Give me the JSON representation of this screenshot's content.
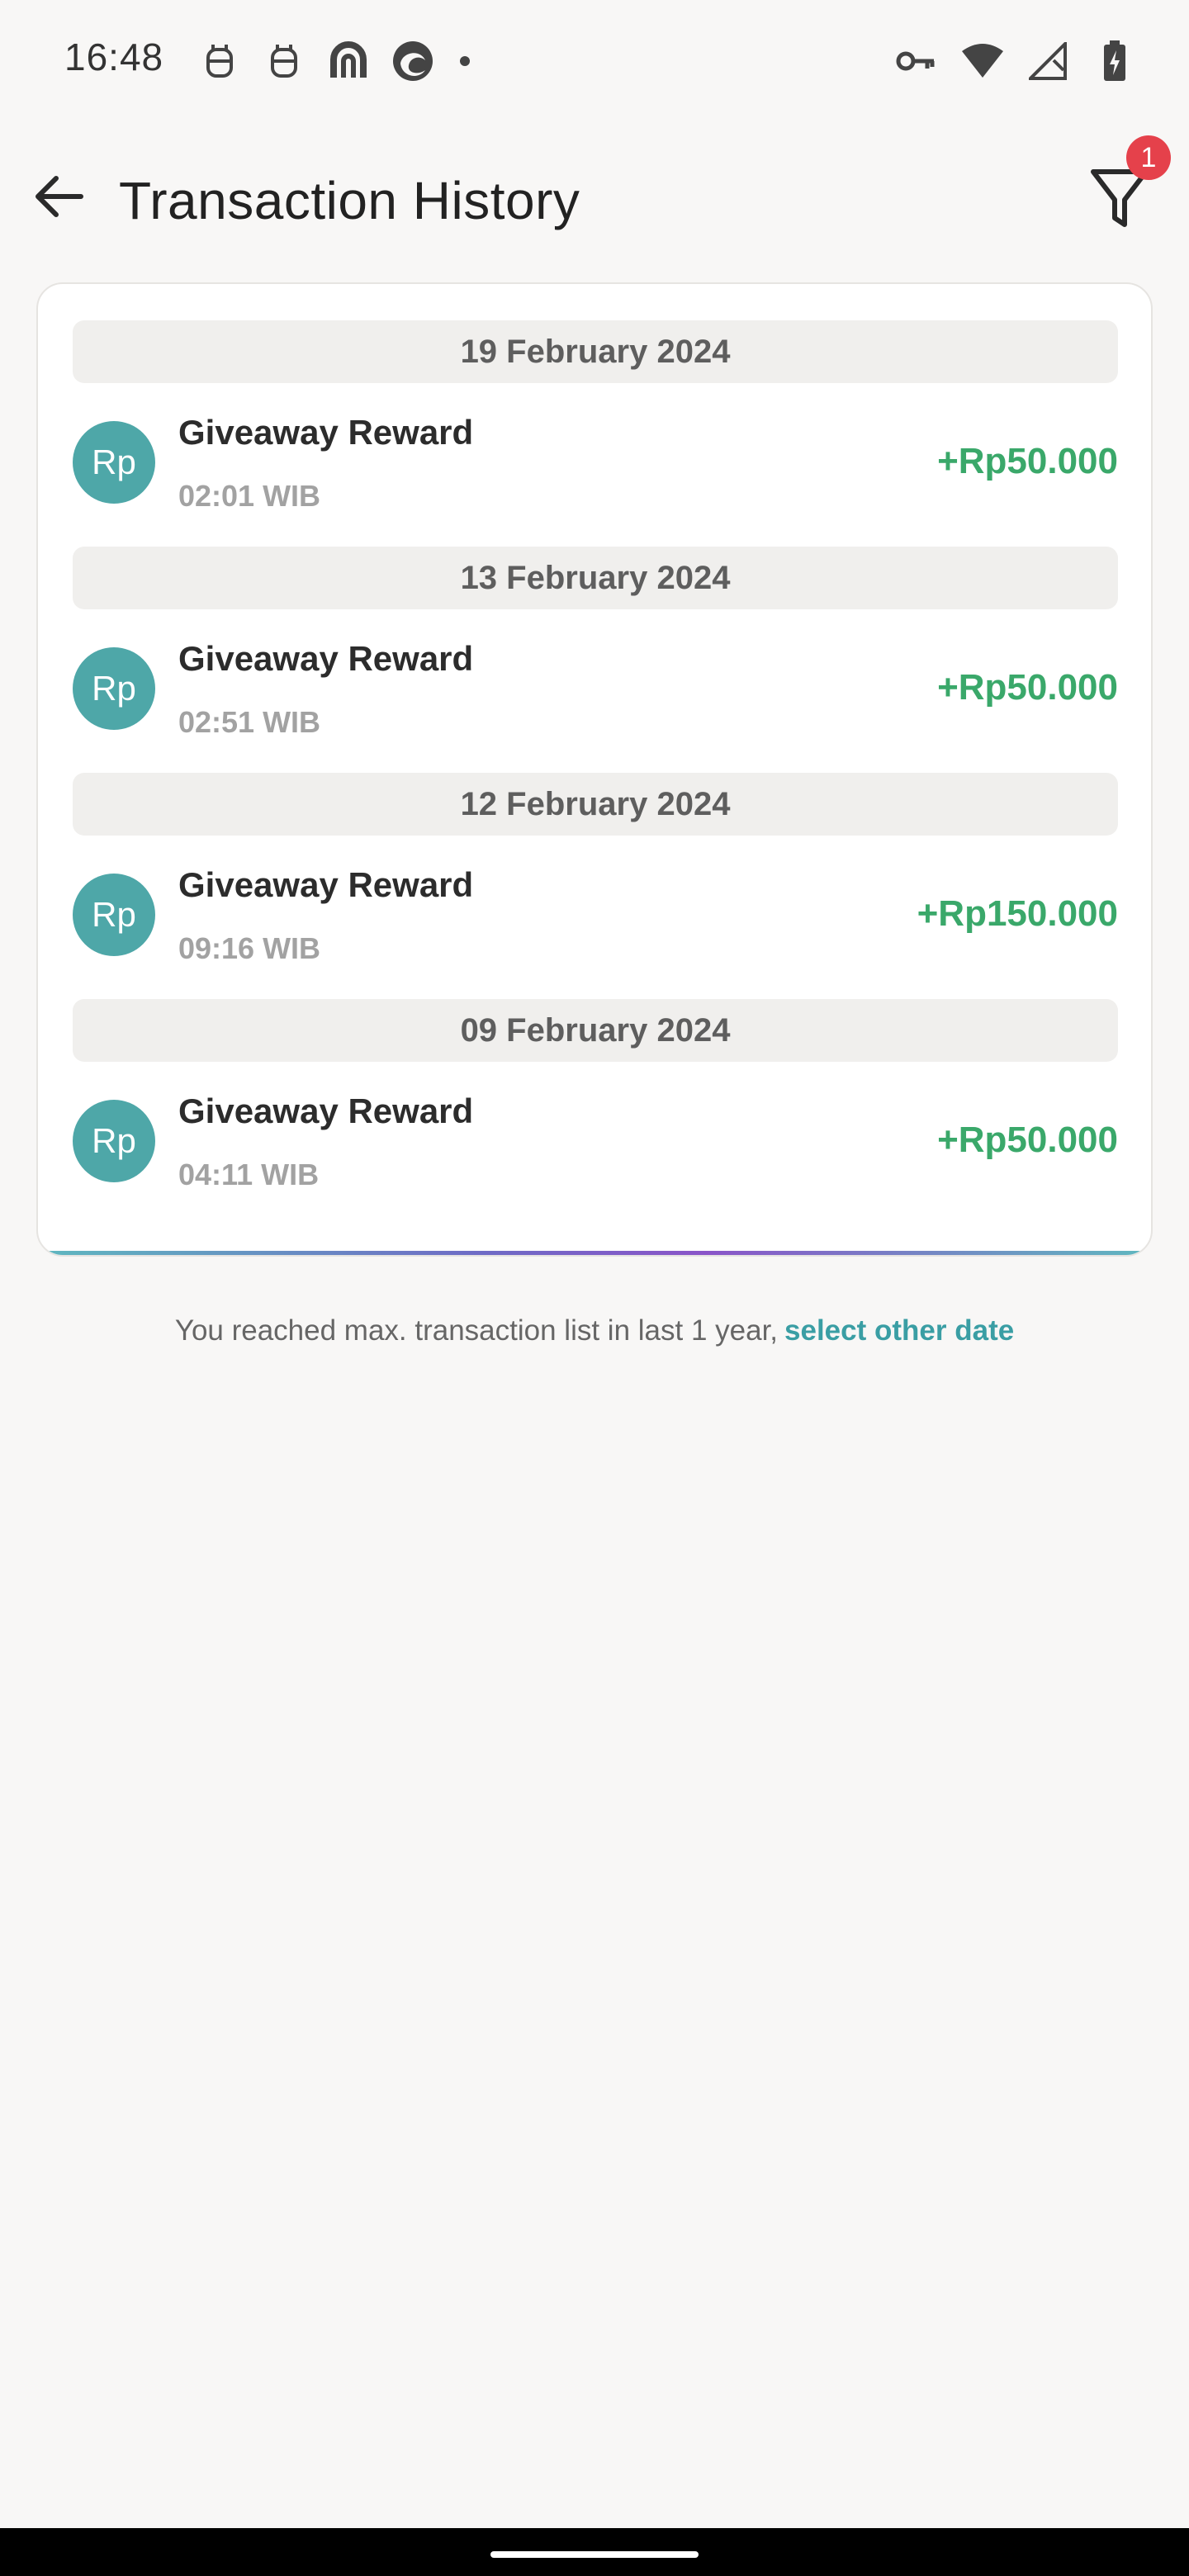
{
  "status_bar": {
    "time": "16:48",
    "left_icons": [
      "robot-icon",
      "robot-icon",
      "app-icon",
      "edge-icon",
      "dot-icon"
    ],
    "right_icons": [
      "key-icon",
      "wifi-icon",
      "signal-icon",
      "battery-icon"
    ]
  },
  "header": {
    "title": "Transaction History",
    "filter_badge_count": "1"
  },
  "transactions": [
    {
      "date": "19 February 2024",
      "avatar": "Rp",
      "title": "Giveaway Reward",
      "time": "02:01 WIB",
      "amount": "+Rp50.000"
    },
    {
      "date": "13 February 2024",
      "avatar": "Rp",
      "title": "Giveaway Reward",
      "time": "02:51 WIB",
      "amount": "+Rp50.000"
    },
    {
      "date": "12 February 2024",
      "avatar": "Rp",
      "title": "Giveaway Reward",
      "time": "09:16 WIB",
      "amount": "+Rp150.000"
    },
    {
      "date": "09 February 2024",
      "avatar": "Rp",
      "title": "Giveaway Reward",
      "time": "04:11 WIB",
      "amount": "+Rp50.000"
    }
  ],
  "footer": {
    "note": "You reached max. transaction list in last 1 year,",
    "link": "select other date"
  },
  "colors": {
    "accent": "#4ea7a8",
    "amount_positive": "#3aa86a",
    "badge": "#e5414b",
    "link": "#3a9ea4"
  }
}
